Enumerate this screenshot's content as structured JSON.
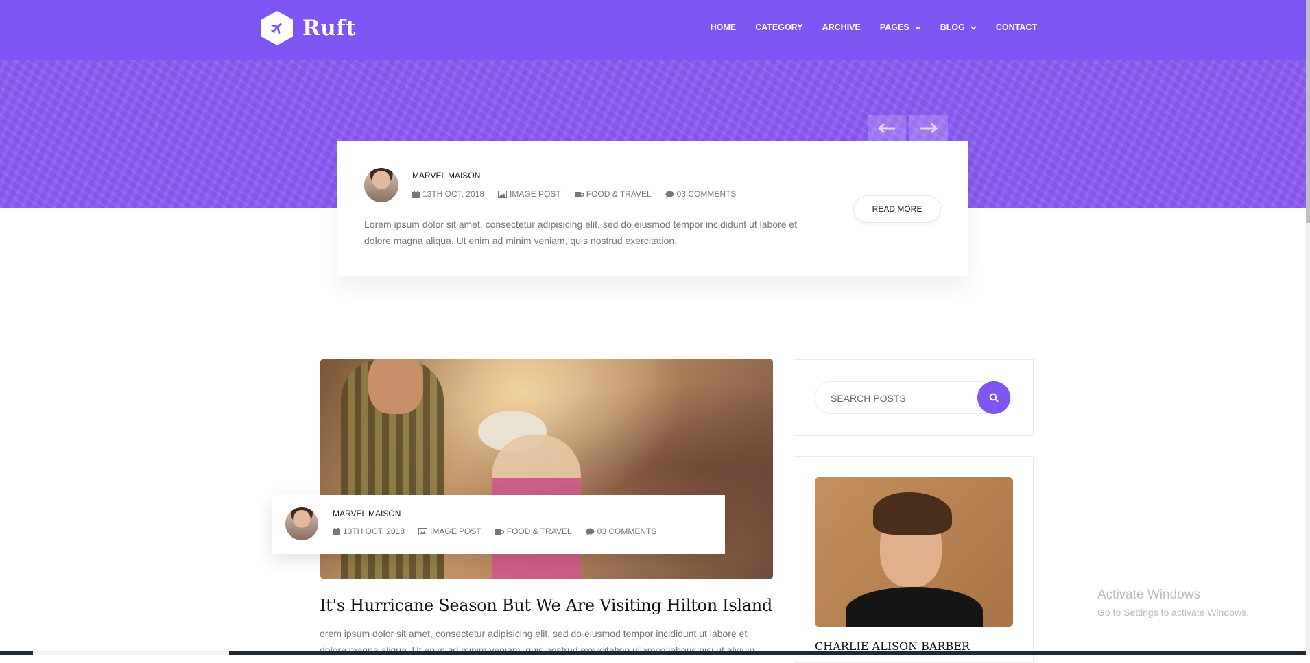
{
  "brand": {
    "name": "Ruft"
  },
  "nav": {
    "items": [
      {
        "label": "HOME"
      },
      {
        "label": "CATEGORY"
      },
      {
        "label": "ARCHIVE"
      },
      {
        "label": "PAGES"
      },
      {
        "label": "BLOG"
      },
      {
        "label": "CONTACT"
      }
    ]
  },
  "featured": {
    "author": "MARVEL MAISON",
    "date": "13TH OCT, 2018",
    "type": "IMAGE POST",
    "category": "FOOD & TRAVEL",
    "comments": "03 COMMENTS",
    "excerpt": "Lorem ipsum dolor sit amet, consectetur adipisicing elit, sed do eiusmod tempor incididunt ut labore et dolore magna aliqua. Ut enim ad minim veniam, quis nostrud exercitation.",
    "read_more": "READ MORE"
  },
  "post": {
    "author": "MARVEL MAISON",
    "date": "13TH OCT, 2018",
    "type": "IMAGE POST",
    "category": "FOOD & TRAVEL",
    "comments": "03 COMMENTS",
    "title": "It's Hurricane Season But We Are Visiting Hilton Island",
    "excerpt": "orem ipsum dolor sit amet, consectetur adipisicing elit, sed do eiusmod tempor incididunt ut labore et dolore magna aliqua. Ut enim ad minim veniam, quis nostrud exercitation ullamco laboris nisi ut aliquip"
  },
  "sidebar": {
    "search_placeholder": "SEARCH POSTS",
    "author_name": "CHARLIE ALISON BARBER"
  },
  "os": {
    "activate_title": "Activate Windows",
    "activate_sub": "Go to Settings to activate Windows."
  },
  "colors": {
    "accent": "#7e55f2",
    "hero": "#8a5cf0"
  }
}
